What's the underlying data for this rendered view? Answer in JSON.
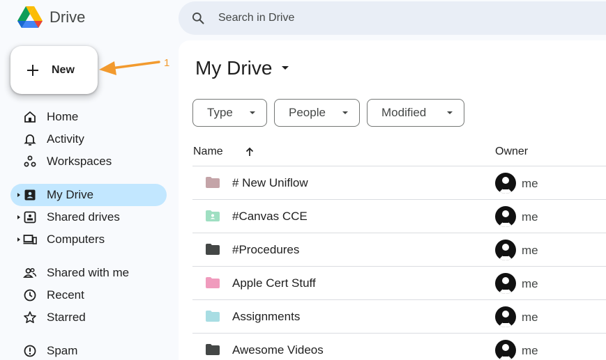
{
  "app": {
    "name": "Drive"
  },
  "search": {
    "placeholder": "Search in Drive"
  },
  "new_button": {
    "label": "New"
  },
  "annotation": {
    "number": "1",
    "color": "#f29a2e"
  },
  "sidebar": {
    "items": [
      {
        "label": "Home",
        "icon": "home-icon"
      },
      {
        "label": "Activity",
        "icon": "bell-icon"
      },
      {
        "label": "Workspaces",
        "icon": "workspaces-icon"
      },
      {
        "label": "My Drive",
        "icon": "my-drive-icon",
        "active": true
      },
      {
        "label": "Shared drives",
        "icon": "shared-drives-icon"
      },
      {
        "label": "Computers",
        "icon": "computers-icon"
      },
      {
        "label": "Shared with me",
        "icon": "people-icon"
      },
      {
        "label": "Recent",
        "icon": "clock-icon"
      },
      {
        "label": "Starred",
        "icon": "star-icon"
      },
      {
        "label": "Spam",
        "icon": "spam-icon"
      }
    ]
  },
  "main": {
    "title": "My Drive",
    "filters": [
      "Type",
      "People",
      "Modified"
    ],
    "columns": {
      "name": "Name",
      "owner": "Owner"
    },
    "rows": [
      {
        "name": "# New Uniflow",
        "owner": "me",
        "color": "#c4a4a8"
      },
      {
        "name": "#Canvas CCE",
        "owner": "me",
        "color": "#9fdfc2"
      },
      {
        "name": "#Procedures",
        "owner": "me",
        "color": "#444746"
      },
      {
        "name": "Apple Cert Stuff",
        "owner": "me",
        "color": "#f09bbd"
      },
      {
        "name": "Assignments",
        "owner": "me",
        "color": "#a8dde3"
      },
      {
        "name": "Awesome Videos",
        "owner": "me",
        "color": "#444746"
      }
    ]
  },
  "colors": {
    "accent": "#c2e7ff",
    "background": "#f8fafd",
    "search_bg": "#e9eef6"
  }
}
